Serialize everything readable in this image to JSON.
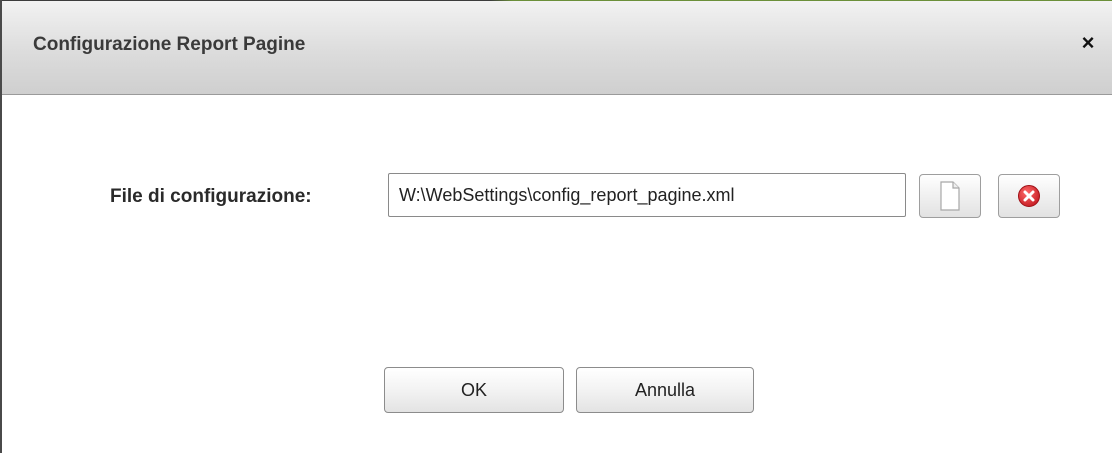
{
  "dialog": {
    "title": "Configurazione Report Pagine",
    "close_symbol": "×"
  },
  "config_field": {
    "label": "File di configurazione:",
    "value": "W:\\WebSettings\\config_report_pagine.xml"
  },
  "icons": {
    "browse": "blank-document-icon",
    "clear": "red-x-circle-icon"
  },
  "buttons": {
    "ok_label": "OK",
    "cancel_label": "Annulla"
  },
  "colors": {
    "clear_icon_red": "#d9282f"
  }
}
